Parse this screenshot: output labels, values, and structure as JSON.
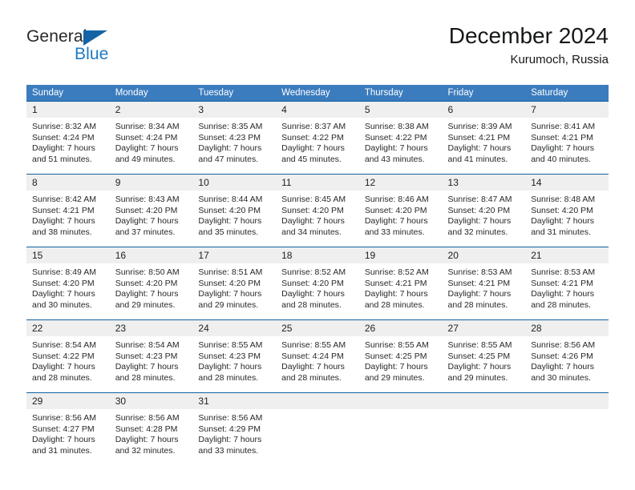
{
  "brand": {
    "name_part1": "General",
    "name_part2": "Blue",
    "triangle_color": "#1464a5",
    "blue_color": "#1f7ac4"
  },
  "header": {
    "title": "December 2024",
    "subtitle": "Kurumoch, Russia"
  },
  "theme": {
    "header_bg": "#3b7cbe",
    "header_text": "#ffffff",
    "row_border": "#11629f",
    "daynum_bg": "#efefef",
    "body_text": "#26282a"
  },
  "calendar": {
    "weekday_headers": [
      "Sunday",
      "Monday",
      "Tuesday",
      "Wednesday",
      "Thursday",
      "Friday",
      "Saturday"
    ],
    "weeks": [
      [
        {
          "day": "1",
          "sunrise": "Sunrise: 8:32 AM",
          "sunset": "Sunset: 4:24 PM",
          "daylight_line1": "Daylight: 7 hours",
          "daylight_line2": "and 51 minutes."
        },
        {
          "day": "2",
          "sunrise": "Sunrise: 8:34 AM",
          "sunset": "Sunset: 4:24 PM",
          "daylight_line1": "Daylight: 7 hours",
          "daylight_line2": "and 49 minutes."
        },
        {
          "day": "3",
          "sunrise": "Sunrise: 8:35 AM",
          "sunset": "Sunset: 4:23 PM",
          "daylight_line1": "Daylight: 7 hours",
          "daylight_line2": "and 47 minutes."
        },
        {
          "day": "4",
          "sunrise": "Sunrise: 8:37 AM",
          "sunset": "Sunset: 4:22 PM",
          "daylight_line1": "Daylight: 7 hours",
          "daylight_line2": "and 45 minutes."
        },
        {
          "day": "5",
          "sunrise": "Sunrise: 8:38 AM",
          "sunset": "Sunset: 4:22 PM",
          "daylight_line1": "Daylight: 7 hours",
          "daylight_line2": "and 43 minutes."
        },
        {
          "day": "6",
          "sunrise": "Sunrise: 8:39 AM",
          "sunset": "Sunset: 4:21 PM",
          "daylight_line1": "Daylight: 7 hours",
          "daylight_line2": "and 41 minutes."
        },
        {
          "day": "7",
          "sunrise": "Sunrise: 8:41 AM",
          "sunset": "Sunset: 4:21 PM",
          "daylight_line1": "Daylight: 7 hours",
          "daylight_line2": "and 40 minutes."
        }
      ],
      [
        {
          "day": "8",
          "sunrise": "Sunrise: 8:42 AM",
          "sunset": "Sunset: 4:21 PM",
          "daylight_line1": "Daylight: 7 hours",
          "daylight_line2": "and 38 minutes."
        },
        {
          "day": "9",
          "sunrise": "Sunrise: 8:43 AM",
          "sunset": "Sunset: 4:20 PM",
          "daylight_line1": "Daylight: 7 hours",
          "daylight_line2": "and 37 minutes."
        },
        {
          "day": "10",
          "sunrise": "Sunrise: 8:44 AM",
          "sunset": "Sunset: 4:20 PM",
          "daylight_line1": "Daylight: 7 hours",
          "daylight_line2": "and 35 minutes."
        },
        {
          "day": "11",
          "sunrise": "Sunrise: 8:45 AM",
          "sunset": "Sunset: 4:20 PM",
          "daylight_line1": "Daylight: 7 hours",
          "daylight_line2": "and 34 minutes."
        },
        {
          "day": "12",
          "sunrise": "Sunrise: 8:46 AM",
          "sunset": "Sunset: 4:20 PM",
          "daylight_line1": "Daylight: 7 hours",
          "daylight_line2": "and 33 minutes."
        },
        {
          "day": "13",
          "sunrise": "Sunrise: 8:47 AM",
          "sunset": "Sunset: 4:20 PM",
          "daylight_line1": "Daylight: 7 hours",
          "daylight_line2": "and 32 minutes."
        },
        {
          "day": "14",
          "sunrise": "Sunrise: 8:48 AM",
          "sunset": "Sunset: 4:20 PM",
          "daylight_line1": "Daylight: 7 hours",
          "daylight_line2": "and 31 minutes."
        }
      ],
      [
        {
          "day": "15",
          "sunrise": "Sunrise: 8:49 AM",
          "sunset": "Sunset: 4:20 PM",
          "daylight_line1": "Daylight: 7 hours",
          "daylight_line2": "and 30 minutes."
        },
        {
          "day": "16",
          "sunrise": "Sunrise: 8:50 AM",
          "sunset": "Sunset: 4:20 PM",
          "daylight_line1": "Daylight: 7 hours",
          "daylight_line2": "and 29 minutes."
        },
        {
          "day": "17",
          "sunrise": "Sunrise: 8:51 AM",
          "sunset": "Sunset: 4:20 PM",
          "daylight_line1": "Daylight: 7 hours",
          "daylight_line2": "and 29 minutes."
        },
        {
          "day": "18",
          "sunrise": "Sunrise: 8:52 AM",
          "sunset": "Sunset: 4:20 PM",
          "daylight_line1": "Daylight: 7 hours",
          "daylight_line2": "and 28 minutes."
        },
        {
          "day": "19",
          "sunrise": "Sunrise: 8:52 AM",
          "sunset": "Sunset: 4:21 PM",
          "daylight_line1": "Daylight: 7 hours",
          "daylight_line2": "and 28 minutes."
        },
        {
          "day": "20",
          "sunrise": "Sunrise: 8:53 AM",
          "sunset": "Sunset: 4:21 PM",
          "daylight_line1": "Daylight: 7 hours",
          "daylight_line2": "and 28 minutes."
        },
        {
          "day": "21",
          "sunrise": "Sunrise: 8:53 AM",
          "sunset": "Sunset: 4:21 PM",
          "daylight_line1": "Daylight: 7 hours",
          "daylight_line2": "and 28 minutes."
        }
      ],
      [
        {
          "day": "22",
          "sunrise": "Sunrise: 8:54 AM",
          "sunset": "Sunset: 4:22 PM",
          "daylight_line1": "Daylight: 7 hours",
          "daylight_line2": "and 28 minutes."
        },
        {
          "day": "23",
          "sunrise": "Sunrise: 8:54 AM",
          "sunset": "Sunset: 4:23 PM",
          "daylight_line1": "Daylight: 7 hours",
          "daylight_line2": "and 28 minutes."
        },
        {
          "day": "24",
          "sunrise": "Sunrise: 8:55 AM",
          "sunset": "Sunset: 4:23 PM",
          "daylight_line1": "Daylight: 7 hours",
          "daylight_line2": "and 28 minutes."
        },
        {
          "day": "25",
          "sunrise": "Sunrise: 8:55 AM",
          "sunset": "Sunset: 4:24 PM",
          "daylight_line1": "Daylight: 7 hours",
          "daylight_line2": "and 28 minutes."
        },
        {
          "day": "26",
          "sunrise": "Sunrise: 8:55 AM",
          "sunset": "Sunset: 4:25 PM",
          "daylight_line1": "Daylight: 7 hours",
          "daylight_line2": "and 29 minutes."
        },
        {
          "day": "27",
          "sunrise": "Sunrise: 8:55 AM",
          "sunset": "Sunset: 4:25 PM",
          "daylight_line1": "Daylight: 7 hours",
          "daylight_line2": "and 29 minutes."
        },
        {
          "day": "28",
          "sunrise": "Sunrise: 8:56 AM",
          "sunset": "Sunset: 4:26 PM",
          "daylight_line1": "Daylight: 7 hours",
          "daylight_line2": "and 30 minutes."
        }
      ],
      [
        {
          "day": "29",
          "sunrise": "Sunrise: 8:56 AM",
          "sunset": "Sunset: 4:27 PM",
          "daylight_line1": "Daylight: 7 hours",
          "daylight_line2": "and 31 minutes."
        },
        {
          "day": "30",
          "sunrise": "Sunrise: 8:56 AM",
          "sunset": "Sunset: 4:28 PM",
          "daylight_line1": "Daylight: 7 hours",
          "daylight_line2": "and 32 minutes."
        },
        {
          "day": "31",
          "sunrise": "Sunrise: 8:56 AM",
          "sunset": "Sunset: 4:29 PM",
          "daylight_line1": "Daylight: 7 hours",
          "daylight_line2": "and 33 minutes."
        },
        {
          "day": "",
          "sunrise": "",
          "sunset": "",
          "daylight_line1": "",
          "daylight_line2": ""
        },
        {
          "day": "",
          "sunrise": "",
          "sunset": "",
          "daylight_line1": "",
          "daylight_line2": ""
        },
        {
          "day": "",
          "sunrise": "",
          "sunset": "",
          "daylight_line1": "",
          "daylight_line2": ""
        },
        {
          "day": "",
          "sunrise": "",
          "sunset": "",
          "daylight_line1": "",
          "daylight_line2": ""
        }
      ]
    ]
  }
}
